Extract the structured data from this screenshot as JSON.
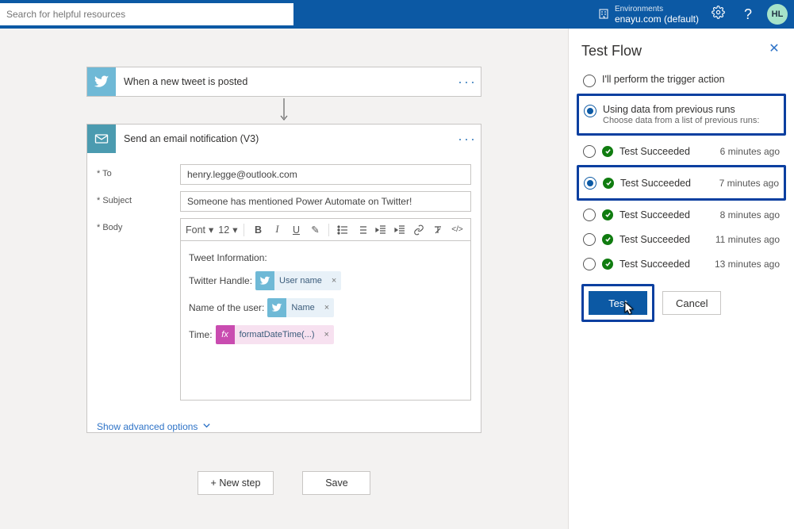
{
  "header": {
    "search_placeholder": "Search for helpful resources",
    "env_label": "Environments",
    "env_value": "enayu.com (default)",
    "avatar": "HL"
  },
  "designer": {
    "trigger": {
      "title": "When a new tweet is posted"
    },
    "action": {
      "title": "Send an email notification (V3)",
      "fields": {
        "to_label": "To",
        "to_value": "henry.legge@outlook.com",
        "subject_label": "Subject",
        "subject_value": "Someone has mentioned Power Automate on Twitter!",
        "body_label": "Body",
        "rte": {
          "font_label": "Font",
          "size_label": "12"
        },
        "body_lines": {
          "l0": "Tweet Information:",
          "l1_prefix": "Twitter Handle:",
          "l1_token": "User name",
          "l2_prefix": "Name of the user:",
          "l2_token": "Name",
          "l3_prefix": "Time:",
          "l3_token": "formatDateTime(...)"
        }
      },
      "advanced": "Show advanced options"
    },
    "footer": {
      "new_step": "+ New step",
      "save": "Save"
    }
  },
  "panel": {
    "title": "Test Flow",
    "opt1": "I'll perform the trigger action",
    "opt2": "Using data from previous runs",
    "opt2_sub": "Choose data from a list of previous runs:",
    "runs": [
      {
        "label": "Test Succeeded",
        "time": "6 minutes ago",
        "selected": false
      },
      {
        "label": "Test Succeeded",
        "time": "7 minutes ago",
        "selected": true
      },
      {
        "label": "Test Succeeded",
        "time": "8 minutes ago",
        "selected": false
      },
      {
        "label": "Test Succeeded",
        "time": "11 minutes ago",
        "selected": false
      },
      {
        "label": "Test Succeeded",
        "time": "13 minutes ago",
        "selected": false
      }
    ],
    "test_btn": "Test",
    "cancel_btn": "Cancel"
  }
}
